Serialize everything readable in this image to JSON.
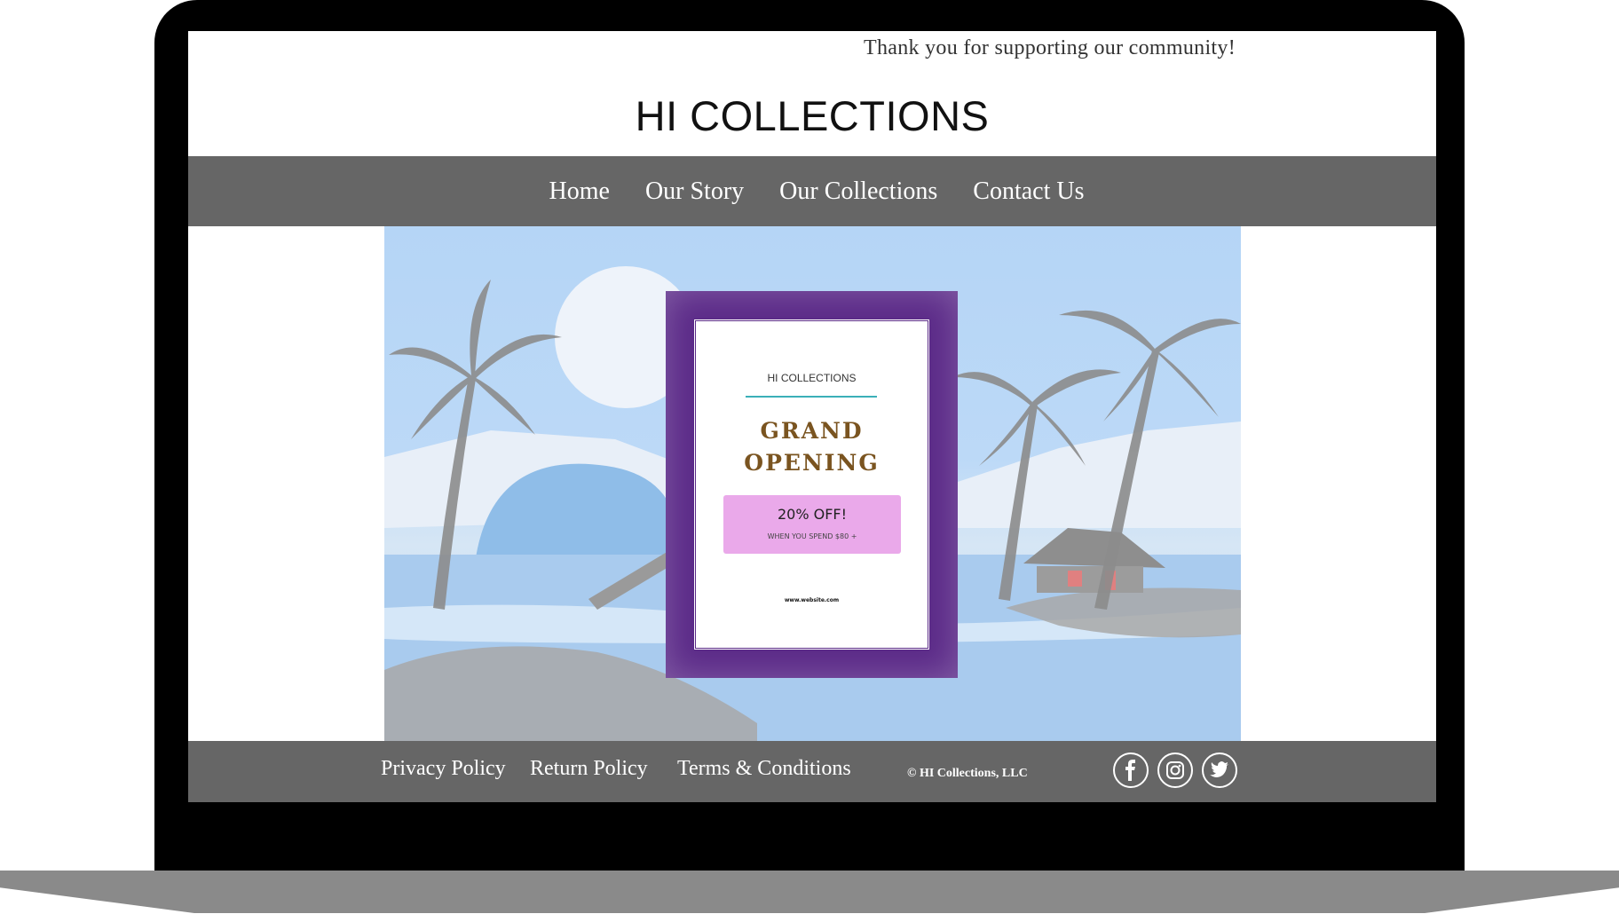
{
  "announcement": "Thank you for supporting our community!",
  "brand": "HI COLLECTIONS",
  "nav": [
    "Home",
    "Our Story",
    "Our Collections",
    "Contact Us"
  ],
  "flyer": {
    "brand": "HI COLLECTIONS",
    "title_line1": "GRAND",
    "title_line2": "OPENING",
    "offer": "20% OFF!",
    "offer_sub": "WHEN YOU SPEND $80 +",
    "url": "www.website.com"
  },
  "footer": {
    "links": [
      "Privacy Policy",
      "Return Policy",
      "Terms & Conditions"
    ],
    "copyright": "© HI Collections, LLC",
    "social": [
      "facebook-icon",
      "instagram-icon",
      "twitter-icon"
    ]
  },
  "colors": {
    "nav_bg": "#666666",
    "flyer_purple": "#5b2a88",
    "offer_pink": "#eaa9ea",
    "accent_teal": "#3bb0b8"
  }
}
